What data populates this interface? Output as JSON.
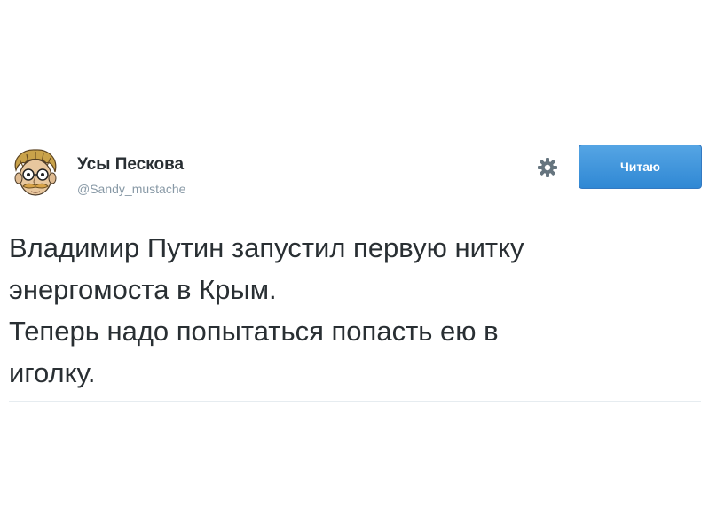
{
  "tweet": {
    "display_name": "Усы Пескова",
    "username": "@Sandy_mustache",
    "follow_label": "Читаю",
    "text_lines": [
      "Владимир Путин запустил первую нитку",
      "энергомоста в Крым.",
      "Теперь надо попытаться попасть ею в",
      "иголку."
    ],
    "avatar_icon": "caricature-avatar",
    "settings_icon": "gear-icon",
    "colors": {
      "follow_button": "#3b94d9",
      "name_text": "#292f33",
      "username_text": "#8899a6"
    }
  }
}
